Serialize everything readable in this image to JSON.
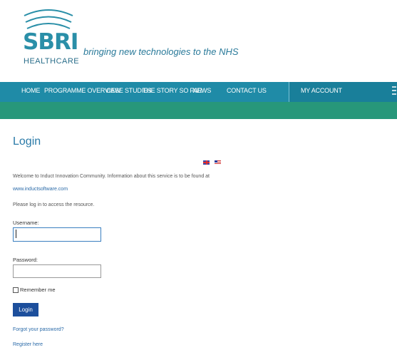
{
  "header": {
    "logo_text": "SBRI",
    "logo_subtext": "HEALTHCARE",
    "tagline": "bringing new technologies to the NHS"
  },
  "nav": {
    "items": [
      {
        "label": "HOME"
      },
      {
        "label": "PROGRAMME OVERVIEW"
      },
      {
        "label": "CASE STUDIES"
      },
      {
        "label": "THE STORY SO FAR"
      },
      {
        "label": "NEWS"
      },
      {
        "label": "CONTACT US"
      }
    ],
    "account_label": "MY ACCOUNT"
  },
  "login": {
    "title": "Login",
    "flags": [
      "uk-flag-icon",
      "us-flag-icon"
    ],
    "welcome_text": "Welcome to Induct Innovation Community. Information about this service is to be found at",
    "site_link": "www.inductsoftware.com",
    "instruction": "Please log in to access the resource.",
    "username_label": "Username:",
    "username_value": "",
    "password_label": "Password:",
    "password_value": "",
    "remember_label": "Remember me",
    "remember_checked": false,
    "login_button": "Login",
    "forgot_link": "Forgot your password?",
    "register_link": "Register here"
  },
  "colors": {
    "nav_bar": "#1f8ba7",
    "sub_bar": "#27977a",
    "brand": "#2a8fa8",
    "button": "#1d4f9c",
    "link": "#2a6aa8"
  }
}
